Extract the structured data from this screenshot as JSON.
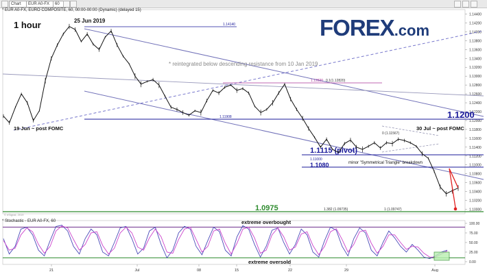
{
  "toolbar": {
    "chart_label": "Chart",
    "symbol": "EUR A0-FX",
    "interval": "60"
  },
  "header": {
    "title": "* EUR A0-FX, EURO COMPOSITE, 60, 00:00-00:00 (Dynamic) (delayed 15)",
    "stoch_title": "* Stochastic - EUR A0-FX, 60"
  },
  "timeframe": "1 hour",
  "logo": {
    "main": "FOREX",
    "suffix": ".com"
  },
  "colors": {
    "price": "#111111",
    "accent_blue": "#1a1a9a",
    "channel": "#7070b8",
    "support_green": "#2e8b2e",
    "projection_red": "#e02020",
    "stoch_k": "#4a4ab8",
    "stoch_d": "#cc44cc"
  },
  "annotations": {
    "high_label": "25 Jun 2019",
    "low_label": "19 Jun ~ post FOMC",
    "resistance_note": "* reintegrated below descending resistance from 10 Jan 2019",
    "jul30_label": "30 Jul ~ post FOMC",
    "pivot_label": "1.1115 (pivot)",
    "support_1080": "1.1080",
    "resistance_1200": "1.1200",
    "support_0975": "1.0975",
    "triangle_note": "minor \"Symmetrical Triangle\" breakdown",
    "fib_1_1414": "1.14140",
    "fib_1_1282a": "1.12820",
    "fib_1_1282b": "0.1(1.12820)",
    "fib_1_1190": "1.11908",
    "fib_1_1100": "1.11000",
    "fib_1_1156": "0 (1.11567)",
    "fib_1382": "1.382 (1.09735)",
    "fib_1": "1 (1.09747)",
    "extreme_overbought": "extreme overbought",
    "extreme_oversold": "extreme oversold",
    "watermark": "© eSignal, 2019"
  },
  "chart_data": [
    {
      "type": "line",
      "title": "1 hour",
      "x": [
        "21",
        "Jul",
        "08",
        "15",
        "22",
        "29",
        "Aug"
      ],
      "y_ticks": [
        "1.14400",
        "1.14200",
        "1.14000",
        "1.13800",
        "1.13600",
        "1.13400",
        "1.13200",
        "1.13000",
        "1.12800",
        "1.12600",
        "1.12400",
        "1.12200",
        "1.12000",
        "1.11800",
        "1.11600",
        "1.11400",
        "1.11200",
        "1.11000",
        "1.10800",
        "1.10600",
        "1.10400",
        "1.10200",
        "1.10000"
      ],
      "ylim": [
        1.099,
        1.145
      ],
      "series": [
        {
          "values": [
            1.121,
            1.1195,
            1.123,
            1.126,
            1.124,
            1.12,
            1.1222,
            1.129,
            1.134,
            1.137,
            1.1395,
            1.1412,
            1.1405,
            1.1378,
            1.1395,
            1.1372,
            1.136,
            1.1388,
            1.1402,
            1.137,
            1.1345,
            1.1328,
            1.13,
            1.1282,
            1.1288,
            1.1292,
            1.128,
            1.1255,
            1.123,
            1.1225,
            1.1218,
            1.1212,
            1.1222,
            1.1218,
            1.1245,
            1.1268,
            1.1262,
            1.1275,
            1.128,
            1.1268,
            1.1272,
            1.1262,
            1.1232,
            1.1218,
            1.1225,
            1.124,
            1.1262,
            1.1282,
            1.1248,
            1.1225,
            1.1205,
            1.1182,
            1.1162,
            1.114,
            1.1158,
            1.1135,
            1.1128,
            1.1148,
            1.1156,
            1.114,
            1.1135,
            1.1142,
            1.115,
            1.1138,
            1.115,
            1.1148,
            1.1158,
            1.1155,
            1.115,
            1.1142,
            1.1125,
            1.1115,
            1.1085,
            1.105,
            1.1035,
            1.1042,
            1.1048
          ]
        }
      ]
    },
    {
      "type": "line",
      "title": "* Stochastic - EUR A0-FX, 60",
      "y_ticks": [
        "100.00",
        "75.00",
        "50.00",
        "25.00",
        "0.00"
      ],
      "ylim": [
        0,
        100
      ],
      "levels": [
        90,
        10
      ],
      "series": [
        {
          "name": "%K",
          "values": [
            60,
            20,
            40,
            85,
            90,
            70,
            30,
            15,
            55,
            92,
            95,
            80,
            40,
            20,
            60,
            85,
            70,
            25,
            15,
            50,
            88,
            92,
            60,
            20,
            35,
            80,
            90,
            45,
            10,
            30,
            75,
            92,
            85,
            40,
            18,
            55,
            90,
            78,
            30,
            15,
            65,
            94,
            85,
            45,
            12,
            40,
            82,
            88,
            50,
            20,
            45,
            85,
            70,
            25,
            12,
            55,
            90,
            82,
            40,
            15,
            60,
            88,
            75,
            30,
            15,
            50,
            80,
            62,
            40,
            25,
            45,
            30,
            12,
            8,
            15,
            25,
            30
          ]
        },
        {
          "name": "%D",
          "values": [
            55,
            30,
            35,
            70,
            88,
            78,
            45,
            22,
            40,
            80,
            93,
            88,
            58,
            30,
            45,
            75,
            78,
            42,
            20,
            35,
            75,
            90,
            75,
            38,
            30,
            62,
            85,
            65,
            25,
            22,
            58,
            85,
            90,
            58,
            25,
            40,
            80,
            85,
            48,
            20,
            48,
            85,
            90,
            62,
            22,
            30,
            70,
            88,
            65,
            30,
            38,
            72,
            78,
            42,
            18,
            40,
            78,
            86,
            58,
            25,
            45,
            78,
            82,
            48,
            22,
            40,
            70,
            70,
            50,
            32,
            40,
            38,
            22,
            12,
            12,
            20,
            28
          ]
        }
      ]
    }
  ]
}
